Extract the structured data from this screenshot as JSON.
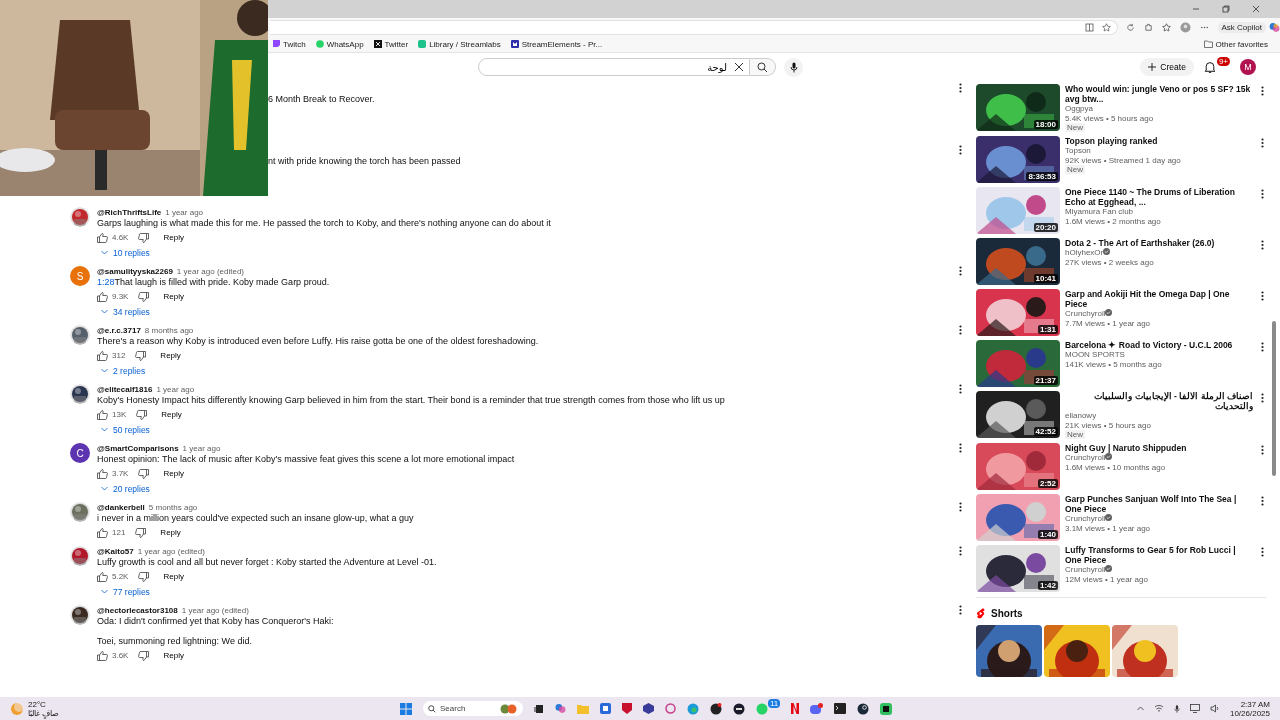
{
  "browser": {
    "ask_copilot": "Ask Copilot",
    "bookmarks": [
      {
        "kind": "twitch",
        "label": "Twitch"
      },
      {
        "kind": "whatsapp",
        "label": "WhatsApp"
      },
      {
        "kind": "x",
        "label": "Twitter"
      },
      {
        "kind": "streamlabs",
        "label": "Library / Streamlabs"
      },
      {
        "kind": "streamelements",
        "label": "StreamElements - Pr..."
      }
    ],
    "other_favorites": "Other favorites"
  },
  "header": {
    "search": {
      "value": "لوحة"
    },
    "create": "Create",
    "notifications_badge": "9+",
    "avatar_letter": "M"
  },
  "webcam": {
    "kind": "picture"
  },
  "partial_comments": [
    {
      "text": "6 Month Break to Recover."
    },
    {
      "text": "nt with pride knowing the torch has been passed"
    }
  ],
  "comments": [
    {
      "author": "@RichThriftsLife",
      "time": "1 year ago",
      "avatar": {
        "kind": "picture"
      },
      "text": [
        "Garps laughing is what made this for me. He passed the torch to Koby, and there's nothing anyone can do about it"
      ],
      "likes": "4.6K",
      "reply": "Reply",
      "replies": "10 replies",
      "menu": false
    },
    {
      "author": "@samulityyska2269",
      "time": "1 year ago (edited)",
      "avatar": {
        "kind": "letter",
        "letter": "S",
        "color": "#e8710a"
      },
      "timestamp": "1:28",
      "text": [
        "That laugh is filled with pride. Koby made Garp proud."
      ],
      "likes": "9.3K",
      "reply": "Reply",
      "replies": "34 replies",
      "menu": true
    },
    {
      "author": "@e.r.c.3717",
      "time": "8 months ago",
      "avatar": {
        "kind": "picture"
      },
      "text": [
        "There's a reason why Koby is introduced even before Luffy. His raise gotta be one of the oldest foreshadowing."
      ],
      "likes": "312",
      "reply": "Reply",
      "replies": "2 replies",
      "menu": true
    },
    {
      "author": "@elitecalf1816",
      "time": "1 year ago",
      "avatar": {
        "kind": "picture"
      },
      "text": [
        "Koby's Honesty Impact hits differently knowing Garp believed in him from the start. Their bond is a reminder that true strength comes from those who lift us up"
      ],
      "likes": "13K",
      "reply": "Reply",
      "replies": "50 replies",
      "menu": true
    },
    {
      "author": "@SmartComparisons",
      "time": "1 year ago",
      "avatar": {
        "kind": "letter",
        "letter": "C",
        "color": "#5e35b1"
      },
      "text": [
        "Honest opinion: The lack of music after Koby's massive feat gives this scene a lot more emotional impact"
      ],
      "likes": "3.7K",
      "reply": "Reply",
      "replies": "20 replies",
      "menu": true
    },
    {
      "author": "@dankerbell",
      "time": "5 months ago",
      "avatar": {
        "kind": "picture"
      },
      "text": [
        "i never in a million years could've expected such an insane glow-up, what a guy"
      ],
      "likes": "121",
      "reply": "Reply",
      "menu": true
    },
    {
      "author": "@Kaito57",
      "time": "1 year ago (edited)",
      "avatar": {
        "kind": "picture"
      },
      "text": [
        "Luffy growth is cool and all but never forget : Koby started the Adventure at Level -01."
      ],
      "likes": "5.2K",
      "reply": "Reply",
      "replies": "77 replies",
      "menu": true
    },
    {
      "author": "@hectorlecastor3108",
      "time": "1 year ago (edited)",
      "avatar": {
        "kind": "picture"
      },
      "text": [
        "Oda: I didn't confirmed yet that Koby has Conqueror's Haki:",
        "Toei, summoning red lightning: We did."
      ],
      "likes": "3.6K",
      "reply": "Reply",
      "menu": true
    }
  ],
  "videos": [
    {
      "title": "Who would win: jungle Veno or pos 5 SF? 15k avg btw...",
      "channel": "Oggpya",
      "verified": false,
      "meta": "5.4K views • 5 hours ago",
      "badge": "New",
      "duration": "18:00"
    },
    {
      "title": "Topson playing ranked",
      "channel": "Topson",
      "verified": false,
      "meta": "92K views • Streamed 1 day ago",
      "badge": "New",
      "duration": "8:36:53"
    },
    {
      "title": "One Piece 1140 ~ The Drums of Liberation Echo at Egghead, ...",
      "channel": "Miyamura Fan club",
      "verified": false,
      "meta": "1.6M views • 2 months ago",
      "duration": "20:20"
    },
    {
      "title": "Dota 2 - The Art of Earthshaker (26.0)",
      "channel": "hOlyhexOr",
      "verified": true,
      "meta": "27K views • 2 weeks ago",
      "duration": "10:41"
    },
    {
      "title": "Garp and Aokiji Hit the Omega Dap | One Piece",
      "channel": "Crunchyroll",
      "verified": true,
      "meta": "7.7M views • 1 year ago",
      "duration": "1:31"
    },
    {
      "title": "Barcelona ✦ Road to Victory - U.C.L 2006",
      "channel": "MOON SPORTS",
      "verified": false,
      "meta": "141K views • 5 months ago",
      "duration": "21:37"
    },
    {
      "title": "اصناف الرملة الالفا - الإيجابيات والسلبيات والتحديات",
      "channel": "elianowy",
      "verified": false,
      "meta": "21K views • 5 hours ago",
      "badge": "New",
      "duration": "42:52"
    },
    {
      "title": "Night Guy | Naruto Shippuden",
      "channel": "Crunchyroll",
      "verified": true,
      "meta": "1.6M views • 10 months ago",
      "duration": "2:52"
    },
    {
      "title": "Garp Punches Sanjuan Wolf Into The Sea | One Piece",
      "channel": "Crunchyroll",
      "verified": true,
      "meta": "3.1M views • 1 year ago",
      "duration": "1:40"
    },
    {
      "title": "Luffy Transforms to Gear 5 for Rob Lucci | One Piece",
      "channel": "Crunchyroll",
      "verified": true,
      "meta": "12M views • 1 year ago",
      "duration": "1:42"
    }
  ],
  "shorts": {
    "title": "Shorts",
    "items": [
      {
        "kind": "picture"
      },
      {
        "kind": "picture"
      },
      {
        "kind": "picture"
      }
    ]
  },
  "taskbar": {
    "temperature": "22°C",
    "weather": "صافٍ غالبًا",
    "search": "Search",
    "whatsapp_badge": "11",
    "time": "2:37 AM",
    "date": "10/26/2025"
  }
}
